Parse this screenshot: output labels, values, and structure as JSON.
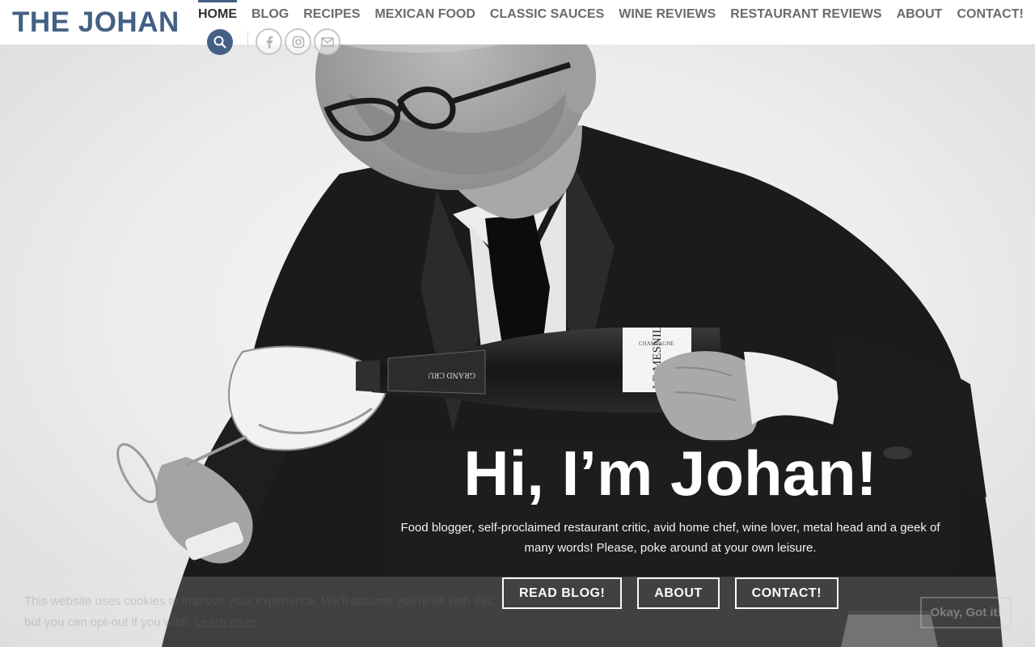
{
  "site": {
    "logo": "THE JOHAN"
  },
  "nav": {
    "items": [
      {
        "label": "HOME",
        "active": true
      },
      {
        "label": "BLOG"
      },
      {
        "label": "RECIPES"
      },
      {
        "label": "MEXICAN FOOD"
      },
      {
        "label": "CLASSIC SAUCES"
      },
      {
        "label": "WINE REVIEWS"
      },
      {
        "label": "RESTAURANT REVIEWS"
      },
      {
        "label": "ABOUT"
      },
      {
        "label": "CONTACT!"
      }
    ]
  },
  "header_icons": {
    "search": "search-icon",
    "social": [
      "facebook-icon",
      "instagram-icon",
      "email-icon"
    ]
  },
  "hero": {
    "title": "Hi, I’m Johan!",
    "description": "Food blogger, self-proclaimed restaurant critic, avid home chef, wine lover, metal head and a geek of many words! Please, poke around at your own leisure.",
    "buttons": [
      "READ BLOG!",
      "ABOUT",
      "CONTACT!"
    ],
    "bottle_label_1": "GRAND CRU",
    "bottle_label_2": "LE MESNIL",
    "bottle_label_3": "CHAMPAGNE"
  },
  "cookie": {
    "text": "This website uses cookies to improve your experience. We'll assume you're ok with this, but you can opt-out if you wish.",
    "link": "Learn more",
    "accept": "Okay, Got it!"
  },
  "colors": {
    "brand": "#446084",
    "overlay": "#1e1e1e",
    "nav_text": "#6b6b6b",
    "nav_active": "#2f2f2f"
  }
}
